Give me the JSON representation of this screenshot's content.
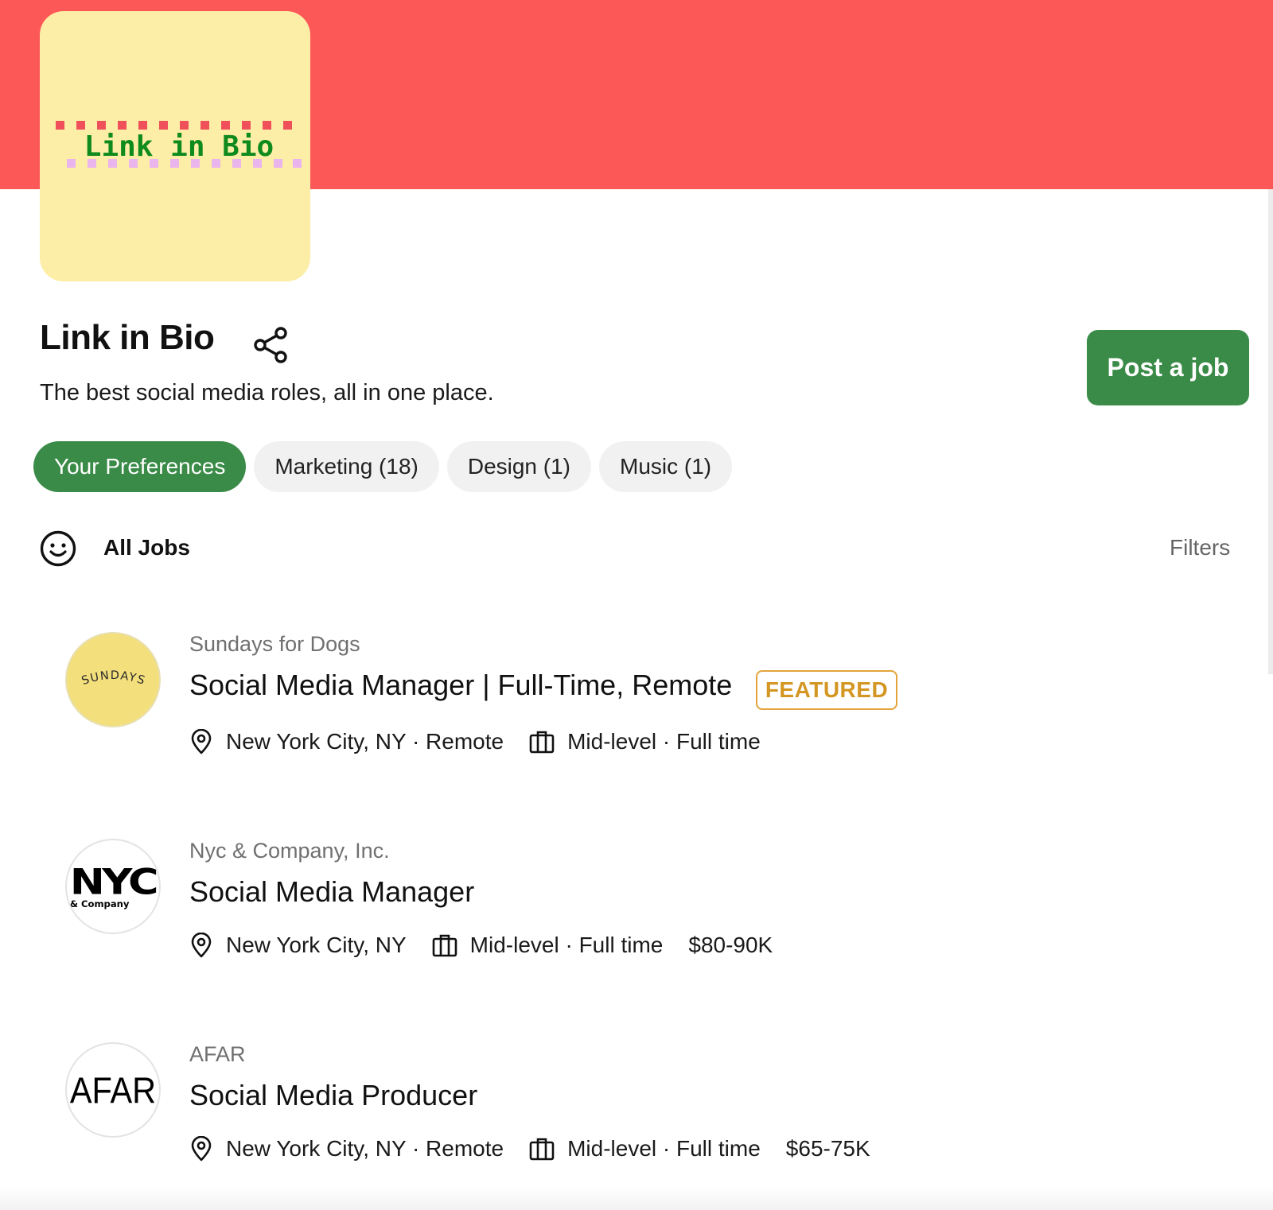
{
  "header": {
    "logo_text": "Link in Bio",
    "title": "Link in Bio",
    "tagline": "The best social media roles, all in one place.",
    "post_button": "Post a job",
    "banner_color": "#fd5858",
    "accent_color": "#3a8b47"
  },
  "tabs": [
    {
      "label": "Your Preferences",
      "active": true
    },
    {
      "label": "Marketing (18)",
      "active": false
    },
    {
      "label": "Design (1)",
      "active": false
    },
    {
      "label": "Music (1)",
      "active": false
    }
  ],
  "list_header": {
    "icon": "smiley-icon",
    "label": "All Jobs",
    "filters": "Filters"
  },
  "jobs": [
    {
      "company": "Sundays for Dogs",
      "logo_text": "SUNDAYS",
      "title": "Social Media Manager | Full-Time, Remote",
      "badge": "FEATURED",
      "location": "New York City, NY · Remote",
      "level": "Mid-level · Full time",
      "salary": ""
    },
    {
      "company": "Nyc & Company, Inc.",
      "logo_text": "NYC",
      "logo_subtext": "& Company",
      "title": "Social Media Manager",
      "location": "New York City, NY",
      "level": "Mid-level · Full time",
      "salary": "$80-90K"
    },
    {
      "company": "AFAR",
      "logo_text": "AFAR",
      "title": "Social Media Producer",
      "location": "New York City, NY · Remote",
      "level": "Mid-level · Full time",
      "salary": "$65-75K"
    }
  ]
}
